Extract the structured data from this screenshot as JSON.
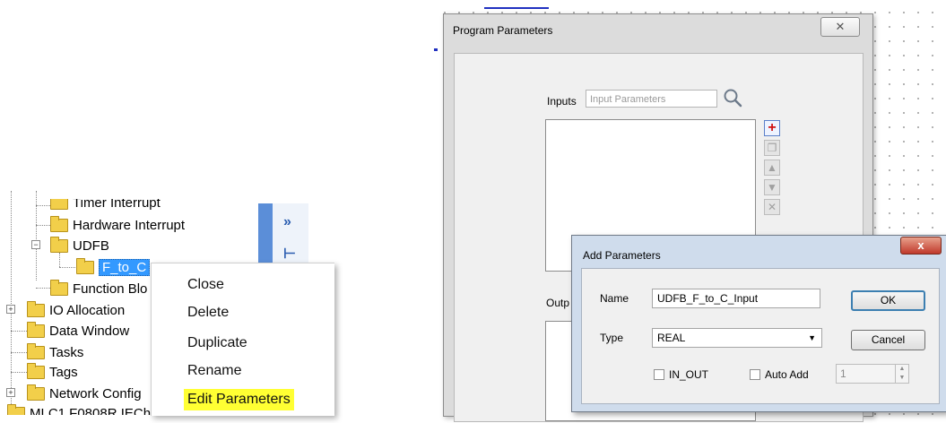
{
  "tree": {
    "items": [
      {
        "label": "Timer Interrupt"
      },
      {
        "label": "Hardware Interrupt"
      },
      {
        "label": "UDFB"
      },
      {
        "label": "F_to_C"
      },
      {
        "label": "Function Blo"
      },
      {
        "label": "IO Allocation"
      },
      {
        "label": "Data Window"
      },
      {
        "label": "Tasks"
      },
      {
        "label": "Tags"
      },
      {
        "label": "Network Config"
      },
      {
        "label": "MLC1 F0808R IECh"
      }
    ],
    "side_buttons": [
      "»",
      "⊢"
    ]
  },
  "context_menu": {
    "items": [
      "Close",
      "Delete",
      "Duplicate",
      "Rename",
      "Edit Parameters"
    ],
    "highlight_color": "#ffff33"
  },
  "program_parameters": {
    "title": "Program Parameters",
    "close_symbol": "✕",
    "inputs_label": "Inputs",
    "search_placeholder": "Input Parameters",
    "outputs_label": "Outp",
    "toolbar": [
      "add-icon",
      "copy-icon",
      "move-up-icon",
      "move-down-icon",
      "delete-icon"
    ]
  },
  "add_parameters": {
    "title": "Add Parameters",
    "close_symbol": "x",
    "name_label": "Name",
    "name_value": "UDFB_F_to_C_Input",
    "type_label": "Type",
    "type_value": "REAL",
    "in_out_label": "IN_OUT",
    "auto_add_label": "Auto Add",
    "auto_add_count": "1",
    "ok_label": "OK",
    "cancel_label": "Cancel"
  }
}
